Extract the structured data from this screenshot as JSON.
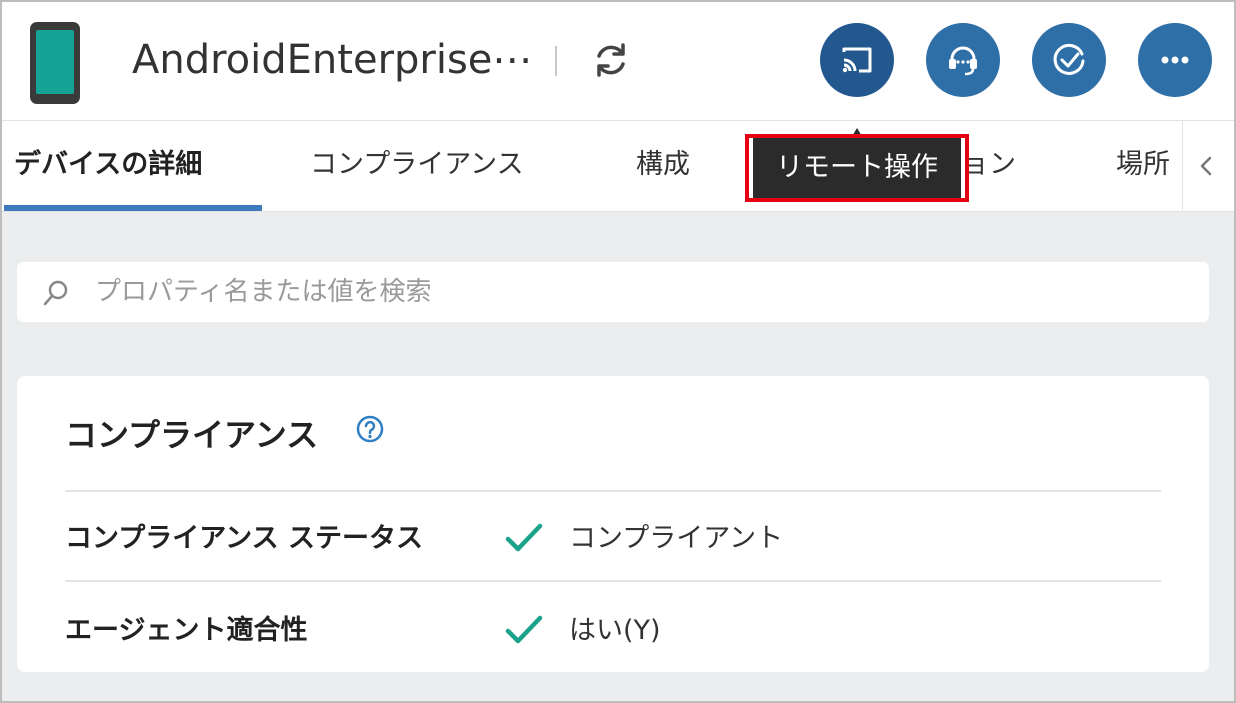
{
  "header": {
    "title": "AndroidEnterprise⋯",
    "device_icon": "android-phone-icon",
    "refresh_icon": "refresh-icon",
    "actions": [
      {
        "name": "remote-control-button",
        "icon": "cast-icon"
      },
      {
        "name": "support-button",
        "icon": "headset-icon"
      },
      {
        "name": "compliance-check-button",
        "icon": "check-circle-icon"
      },
      {
        "name": "more-button",
        "icon": "more-icon"
      }
    ]
  },
  "tabs": [
    {
      "label": "デバイスの詳細",
      "active": true
    },
    {
      "label": "コンプライアンス",
      "active": false
    },
    {
      "label": "構成",
      "active": false
    },
    {
      "label": "ョン",
      "active": false
    },
    {
      "label": "場所",
      "active": false
    }
  ],
  "tooltip": {
    "text": "リモート操作"
  },
  "search": {
    "placeholder": "プロパティ名または値を検索",
    "value": ""
  },
  "compliance_card": {
    "title": "コンプライアンス",
    "rows": [
      {
        "label": "コンプライアンス ステータス",
        "value": "コンプライアント",
        "status_icon": "check-icon"
      },
      {
        "label": "エージェント適合性",
        "value": "はい(Y)",
        "status_icon": "check-icon"
      }
    ]
  },
  "colors": {
    "accent_blue": "#2e6fa8",
    "tab_underline": "#3d7bbd",
    "check_green": "#1aa38a",
    "highlight_red": "#e60012",
    "device_screen": "#14a394"
  }
}
